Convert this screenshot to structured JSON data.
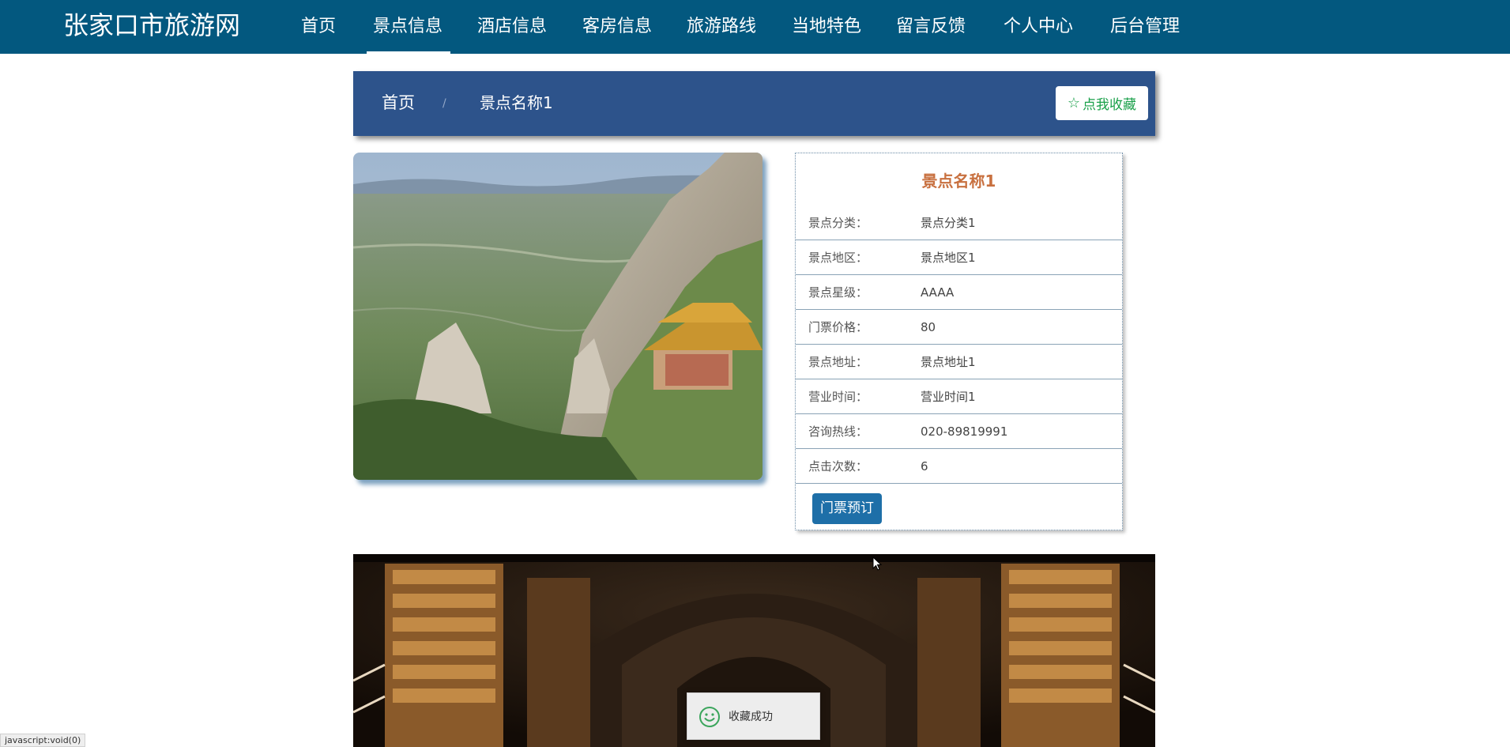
{
  "header": {
    "brand": "张家口市旅游网",
    "nav": [
      {
        "label": "首页"
      },
      {
        "label": "景点信息",
        "active": true
      },
      {
        "label": "酒店信息"
      },
      {
        "label": "客房信息"
      },
      {
        "label": "旅游路线"
      },
      {
        "label": "当地特色"
      },
      {
        "label": "留言反馈"
      },
      {
        "label": "个人中心"
      },
      {
        "label": "后台管理"
      }
    ]
  },
  "breadcrumb": {
    "home": "首页",
    "separator": "/",
    "current": "景点名称1",
    "favorite_label": "点我收藏",
    "favorite_icon": "star-outline-icon"
  },
  "detail": {
    "title": "景点名称1",
    "fields": [
      {
        "label": "景点分类：",
        "value": "景点分类1"
      },
      {
        "label": "景点地区：",
        "value": "景点地区1"
      },
      {
        "label": "景点星级：",
        "value": "AAAA"
      },
      {
        "label": "门票价格：",
        "value": "80"
      },
      {
        "label": "景点地址：",
        "value": "景点地址1"
      },
      {
        "label": "营业时间：",
        "value": "营业时间1"
      },
      {
        "label": "咨询热线：",
        "value": "020-89819991"
      },
      {
        "label": "点击次数：",
        "value": "6"
      }
    ],
    "book_label": "门票预订"
  },
  "toast": {
    "text": "收藏成功",
    "icon": "smiley-icon"
  },
  "statusbar": {
    "text": "javascript:void(0)"
  },
  "colors": {
    "nav_bg": "#03587f",
    "breadcrumb_bg": "#2d538b",
    "title": "#c8703f",
    "favorite": "#1aa04a",
    "button": "#1e6fa8"
  }
}
